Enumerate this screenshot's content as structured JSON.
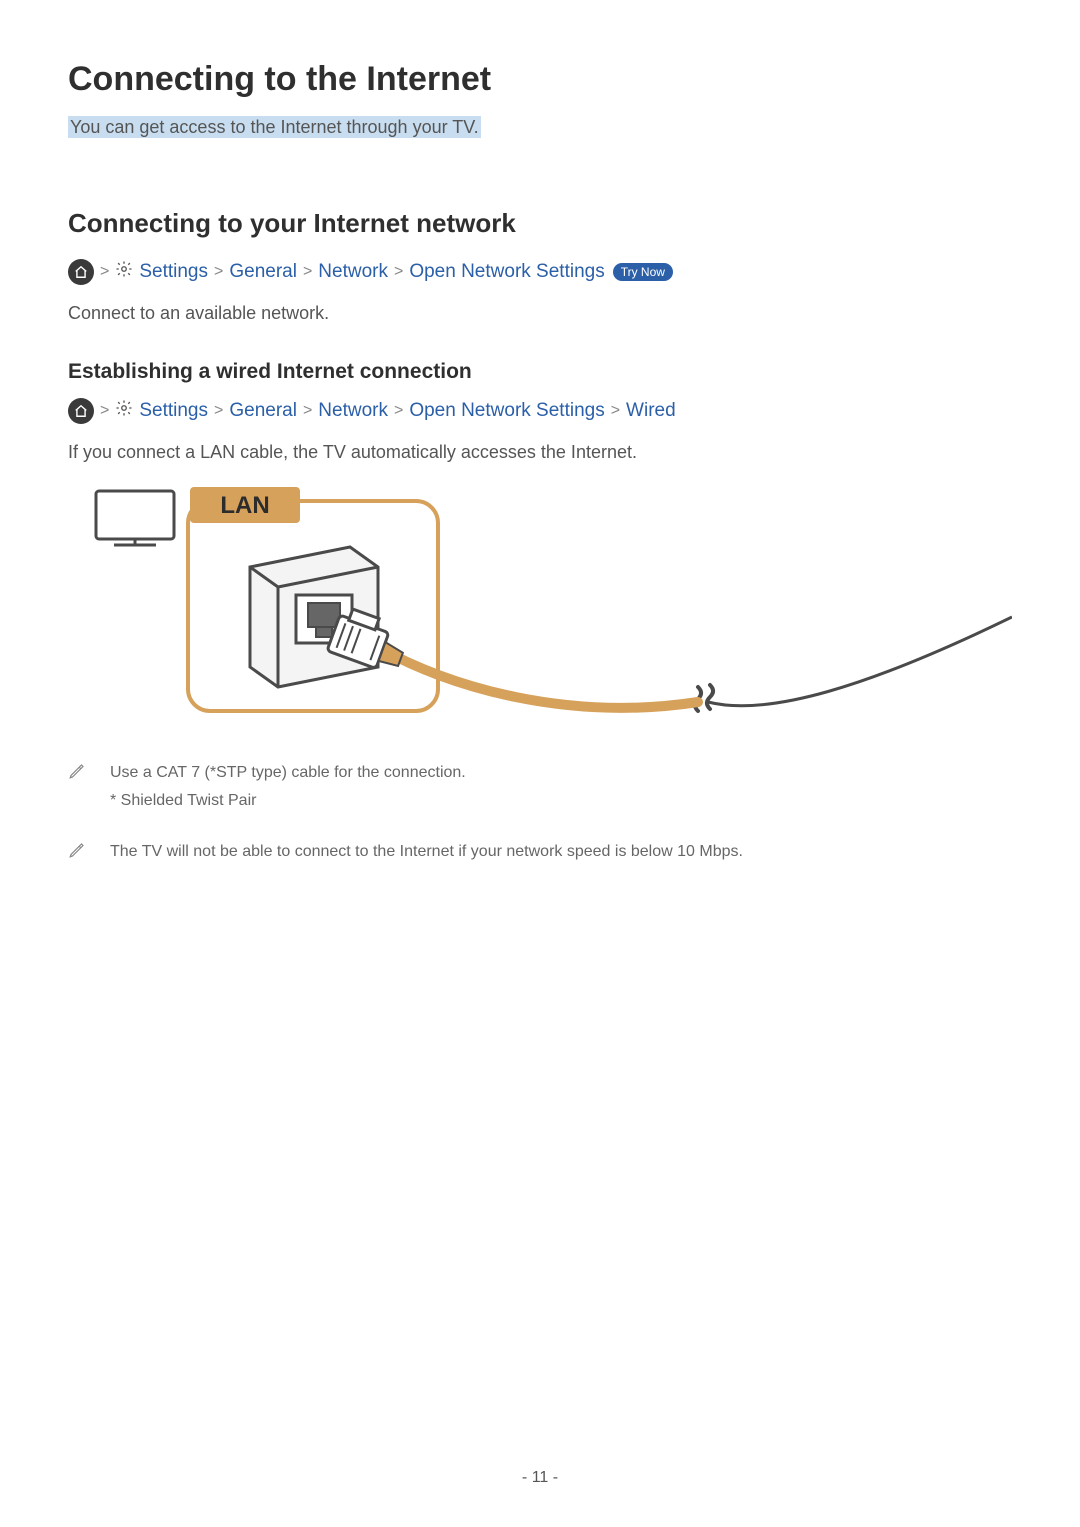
{
  "title": "Connecting to the Internet",
  "subtitle": "You can get access to the Internet through your TV.",
  "section1": {
    "heading": "Connecting to your Internet network",
    "path": {
      "settings": "Settings",
      "general": "General",
      "network": "Network",
      "open_network": "Open Network Settings"
    },
    "trynow": "Try Now",
    "body": "Connect to an available network."
  },
  "section2": {
    "heading": "Establishing a wired Internet connection",
    "path": {
      "settings": "Settings",
      "general": "General",
      "network": "Network",
      "open_network": "Open Network Settings",
      "wired": "Wired"
    },
    "body": "If you connect a LAN cable, the TV automatically accesses the Internet."
  },
  "diagram": {
    "lan_label": "LAN"
  },
  "notes": {
    "n1_line1": "Use a CAT 7 (*STP type) cable for the connection.",
    "n1_line2": "* Shielded Twist Pair",
    "n2": "The TV will not be able to connect to the Internet if your network speed is below 10 Mbps."
  },
  "page_number": "- 11 -",
  "chevron": ">"
}
